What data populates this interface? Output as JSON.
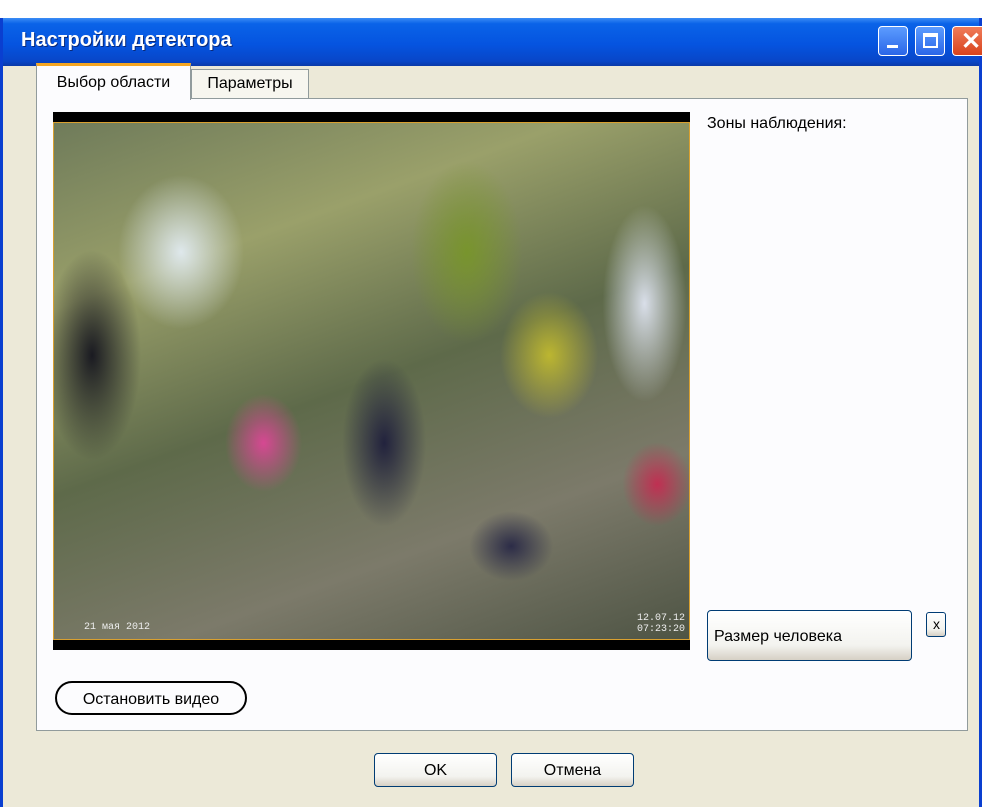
{
  "window": {
    "title": "Настройки детектора"
  },
  "tabs": [
    {
      "label": "Выбор области"
    },
    {
      "label": "Параметры"
    }
  ],
  "video": {
    "osd_left": "21 мая 2012",
    "osd_right_date": "12.07.12",
    "osd_right_time": "07:23:20"
  },
  "zones": {
    "label": "Зоны наблюдения:"
  },
  "buttons": {
    "person_size": "Размер человека",
    "remove": "x",
    "stop_video": "Остановить видео",
    "ok": "OK",
    "cancel": "Отмена"
  },
  "colors": {
    "titlebar": "#0554e0",
    "dialog_bg": "#ece9d8",
    "active_tab_accent": "#f5a623",
    "close_button": "#d8431c"
  },
  "icons": {
    "minimize": "minimize-icon",
    "maximize": "maximize-icon",
    "close": "close-icon"
  }
}
